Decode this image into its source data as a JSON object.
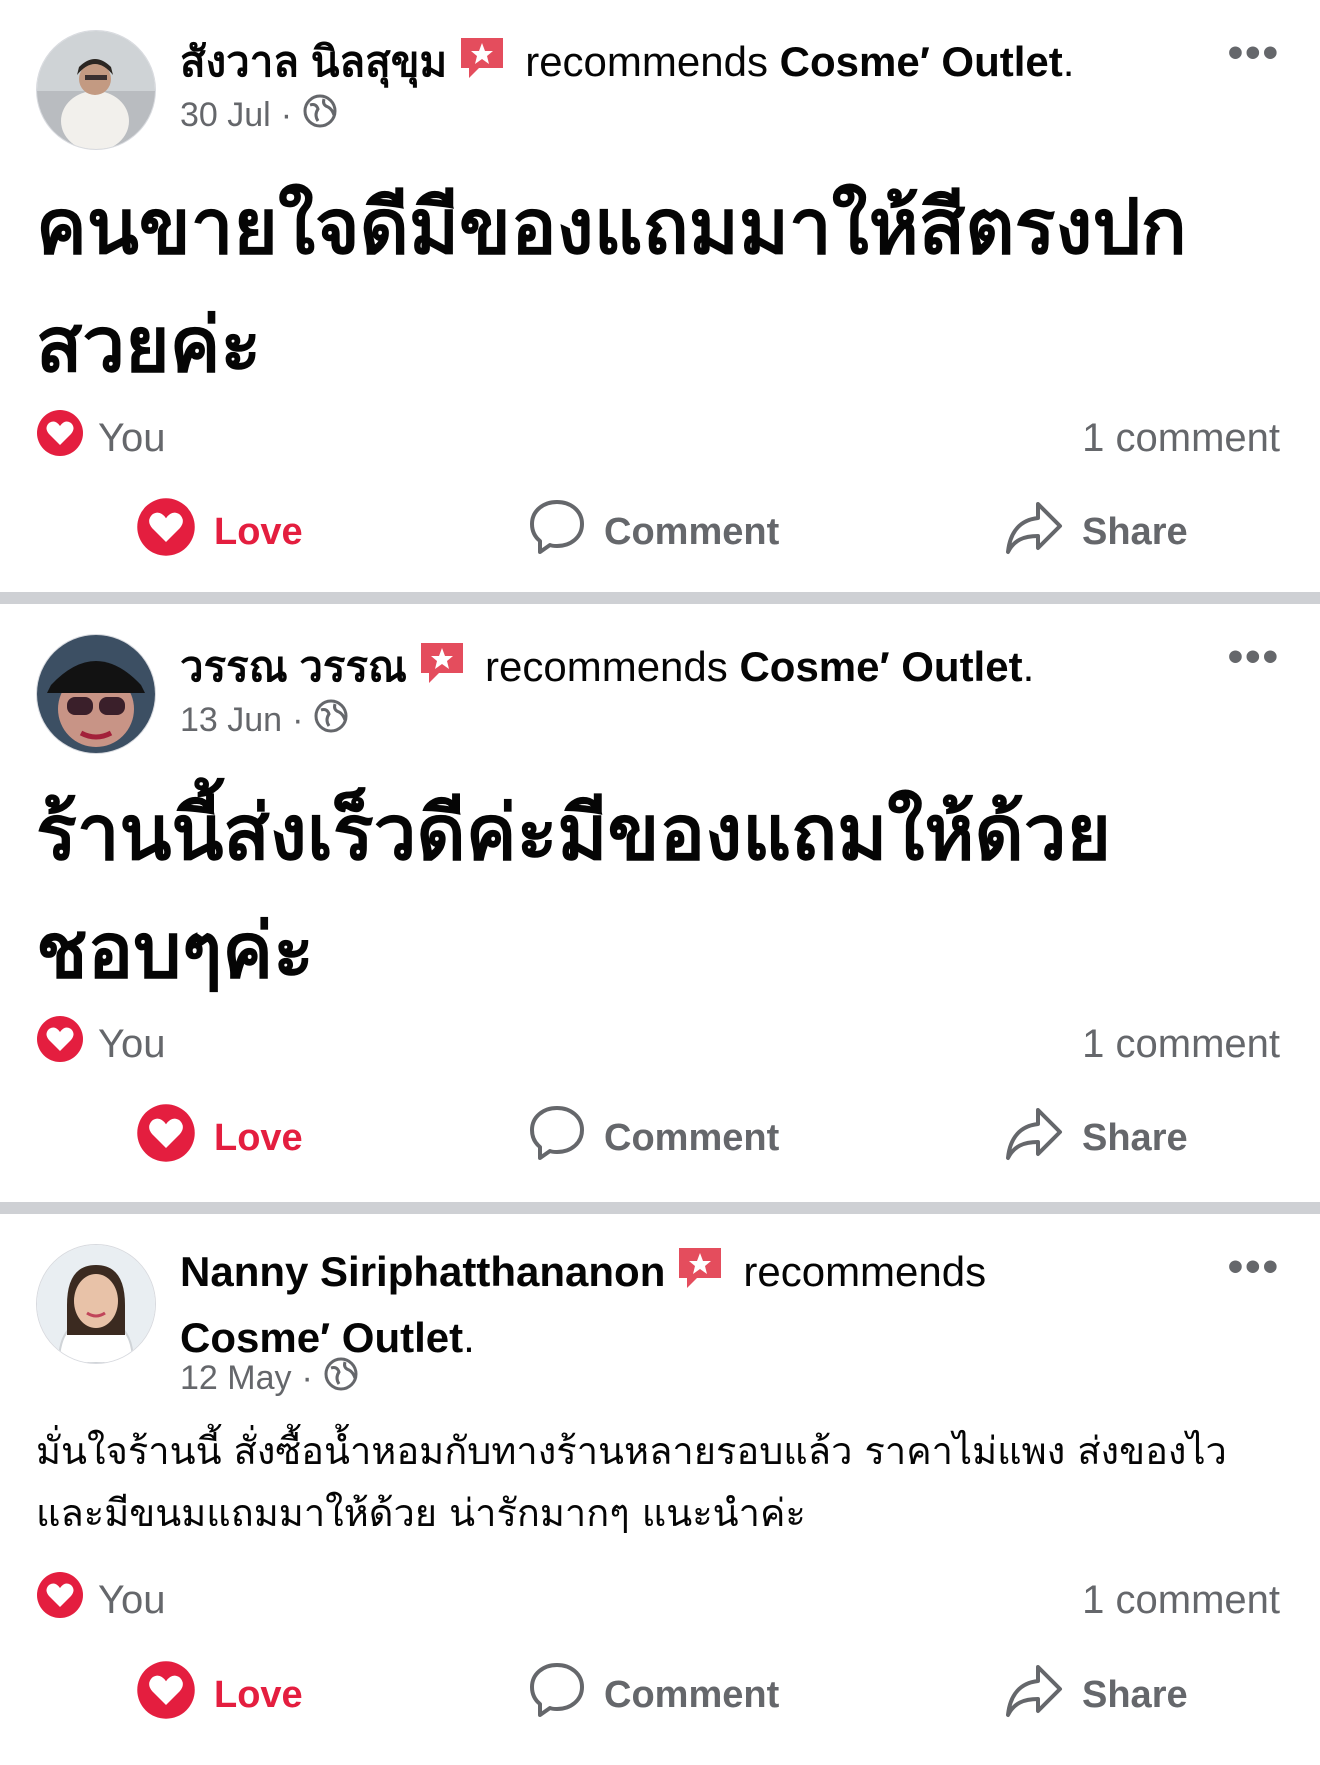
{
  "posts": [
    {
      "author": "สังวาล นิลสุขุม",
      "recommends_text": "recommends",
      "page": "Cosme′ Outlet",
      "date": "30 Jul",
      "text": "คนขายใจดีมีของแถมมาให้สีตรงปกสวยค่ะ",
      "reactor": "You",
      "comment_count": "1 comment"
    },
    {
      "author": "วรรณ วรรณ",
      "recommends_text": "recommends",
      "page": "Cosme′ Outlet",
      "date": "13 Jun",
      "text": "ร้านนี้ส่งเร็วดีค่ะมีของแถมให้ด้วยชอบๆค่ะ",
      "reactor": "You",
      "comment_count": "1 comment"
    },
    {
      "author": "Nanny Siriphatthananon",
      "recommends_text": "recommends",
      "page": "Cosme′ Outlet",
      "date": "12 May",
      "text": "มั่นใจร้านนี้ สั่งซื้อน้ำหอมกับทางร้านหลายรอบแล้ว ราคาไม่แพง ส่งของไวและมีขนมแถมมาให้ด้วย น่ารักมากๆ แนะนำค่ะ",
      "reactor": "You",
      "comment_count": "1 comment"
    }
  ],
  "actions": {
    "love": "Love",
    "comment": "Comment",
    "share": "Share"
  },
  "separators": {
    "dot": "·",
    "period": "."
  },
  "icons": {
    "more": "more-icon",
    "globe": "globe-icon",
    "badge": "recommendation-badge-icon",
    "heart": "heart-icon",
    "comment": "comment-icon",
    "share": "share-icon"
  },
  "colors": {
    "love_red": "#e41e3f",
    "secondary_text": "#65676b",
    "divider": "#ced0d4"
  }
}
